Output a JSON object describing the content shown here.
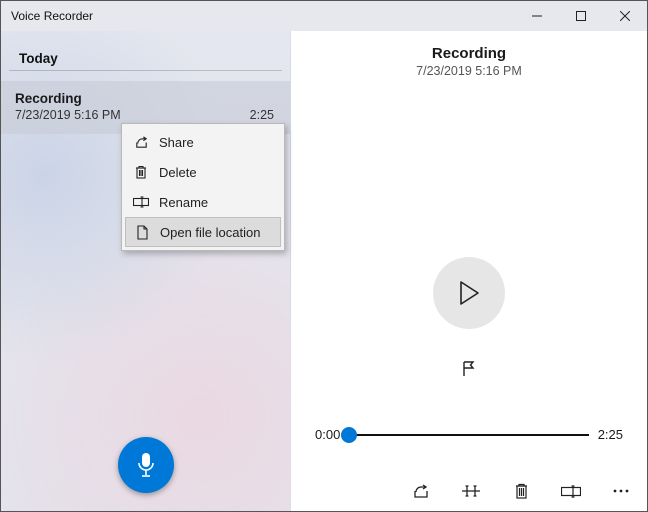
{
  "window": {
    "title": "Voice Recorder"
  },
  "left": {
    "section": "Today",
    "items": [
      {
        "title": "Recording",
        "datetime": "7/23/2019 5:16 PM",
        "duration": "2:25"
      }
    ]
  },
  "context_menu": {
    "items": [
      {
        "label": "Share",
        "icon": "share-icon"
      },
      {
        "label": "Delete",
        "icon": "trash-icon"
      },
      {
        "label": "Rename",
        "icon": "rename-icon"
      },
      {
        "label": "Open file location",
        "icon": "file-icon",
        "hover": true
      }
    ]
  },
  "detail": {
    "title": "Recording",
    "datetime": "7/23/2019 5:16 PM"
  },
  "playback": {
    "position": "0:00",
    "duration": "2:25",
    "progress_pct": 0
  },
  "colors": {
    "accent": "#0078d7"
  }
}
